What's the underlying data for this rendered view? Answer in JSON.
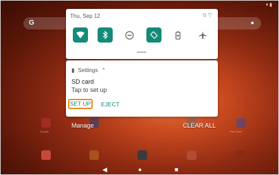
{
  "quick_settings": {
    "date": "Thu, Sep 12",
    "tiles": [
      "wifi",
      "bluetooth",
      "do-not-disturb",
      "auto-rotate",
      "battery-saver",
      "airplane-mode"
    ]
  },
  "notification": {
    "app_name": "Settings",
    "title": "SD card",
    "text": "Tap to set up",
    "primary_action": "SET UP",
    "secondary_action": "EJECT"
  },
  "recents": {
    "manage_label": "Manage",
    "clear_all_label": "CLEAR ALL"
  },
  "home_apps": [
    "Google",
    "Play Store"
  ],
  "colors": {
    "accent": "#148a78",
    "focus_ring": "#e88b25",
    "panel": "#ffffff"
  }
}
